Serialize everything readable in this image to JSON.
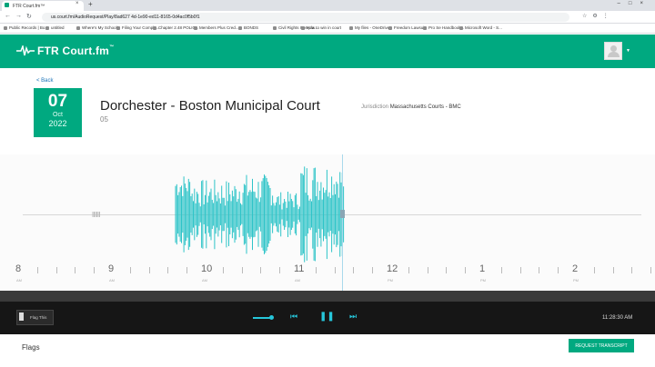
{
  "browser": {
    "tab_title": "FTR Court.fm™",
    "new_tab": "+",
    "address": "us.court.fm/AudioRequest/Play/8ad627 4d-1e90-ed11-8165-0d4ac0f5b0f1",
    "bookmarks": [
      "Public Records | Bo...",
      "untitled",
      "Where's My School...",
      "Filing Your Compla...",
      "Chapter 2.48 POLIC...",
      "Members Plus Cred...",
      "BONDS",
      "Civil Rights Compla...",
      "How to win in court",
      "My files - OneDrive",
      "Freedom Lawsuit",
      "Pro Se Handbook...",
      "Microsoft Word - S..."
    ]
  },
  "header": {
    "logo_text": "FTR Court.fm",
    "logo_tm": "™",
    "brand_color": "#00a980"
  },
  "page": {
    "back_label": "< Back",
    "date_day": "07",
    "date_month": "Oct",
    "date_year": "2022",
    "court_title": "Dorchester - Boston Municipal Court",
    "room": "05",
    "jurisdiction_label": "Jurisdiction",
    "jurisdiction_value": "Massachusetts Courts - BMC"
  },
  "timeline": {
    "ticks": [
      {
        "hour": "8",
        "ampm": "AM"
      },
      {
        "hour": "9",
        "ampm": "AM"
      },
      {
        "hour": "10",
        "ampm": "AM"
      },
      {
        "hour": "11",
        "ampm": "AM"
      },
      {
        "hour": "12",
        "ampm": "PM"
      },
      {
        "hour": "1",
        "ampm": "PM"
      },
      {
        "hour": "2",
        "ampm": "PM"
      }
    ],
    "wave_color": "#2ec4c8"
  },
  "controls": {
    "flag_label": "Flag This",
    "timecode": "11:28:30 AM"
  },
  "footer": {
    "flags_label": "Flags",
    "request_label": "REQUEST TRANSCRIPT"
  }
}
